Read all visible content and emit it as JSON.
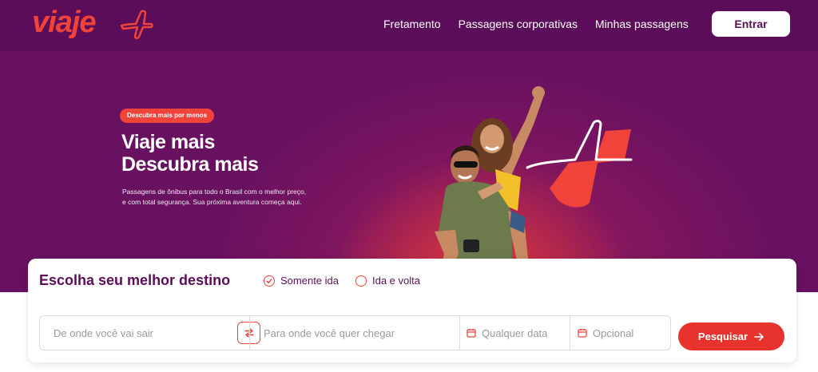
{
  "brand": {
    "logo_text": "viaje",
    "accent": "#f0443a",
    "primary": "#5c0d59"
  },
  "nav": {
    "links": [
      "Fretamento",
      "Passagens corporativas",
      "Minhas passagens"
    ],
    "login_label": "Entrar"
  },
  "hero": {
    "badge": "Descubra mais por menos",
    "title_line1": "Viaje mais",
    "title_line2": "Descubra mais",
    "subtitle_line1": "Passagens de ônibus para todo o Brasil com o melhor preço,",
    "subtitle_line2": "e com total segurança. Sua próxima aventura começa aqui."
  },
  "search": {
    "title": "Escolha seu melhor destino",
    "trip_types": [
      {
        "label": "Somente ida",
        "selected": true
      },
      {
        "label": "Ida e volta",
        "selected": false
      }
    ],
    "origin_placeholder": "De onde você vai sair",
    "destination_placeholder": "Para onde você quer chegar",
    "departure_placeholder": "Qualquer data",
    "return_placeholder": "Opcional",
    "submit_label": "Pesquisar"
  }
}
